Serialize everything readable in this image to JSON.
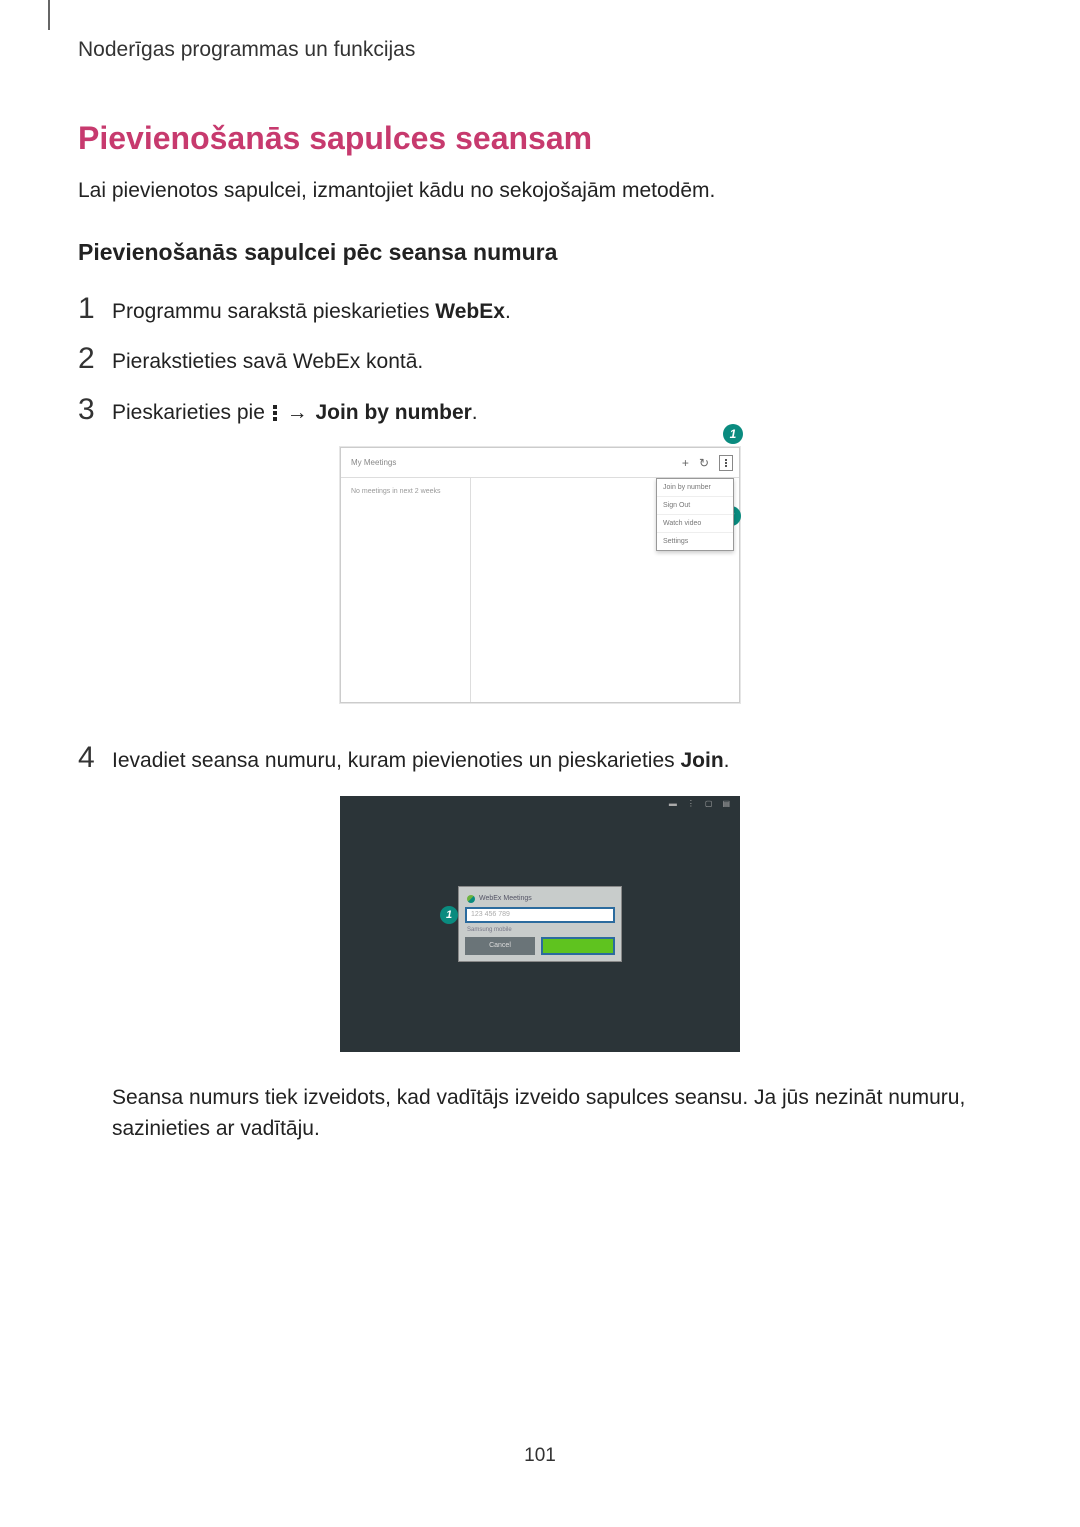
{
  "header": "Noderīgas programmas un funkcijas",
  "title": "Pievienošanās sapulces seansam",
  "intro": "Lai pievienotos sapulcei, izmantojiet kādu no sekojošajām metodēm.",
  "subtitle": "Pievienošanās sapulcei pēc seansa numura",
  "steps": {
    "s1": {
      "num": "1",
      "pre": "Programmu sarakstā pieskarieties ",
      "bold": "WebEx",
      "post": "."
    },
    "s2": {
      "num": "2",
      "text": "Pierakstieties savā WebEx kontā."
    },
    "s3": {
      "num": "3",
      "pre": "Pieskarieties pie ",
      "arrow": "→",
      "bold": "Join by number",
      "post": "."
    },
    "s4": {
      "num": "4",
      "pre": "Ievadiet seansa numuru, kuram pievienoties un pieskarieties ",
      "bold": "Join",
      "post": "."
    }
  },
  "shot1": {
    "title": "My Meetings",
    "empty": "No meetings in next 2 weeks",
    "menu": [
      "Join by number",
      "Sign Out",
      "Watch video",
      "Settings"
    ]
  },
  "shot2": {
    "dialog_title": "WebEx Meetings",
    "input_placeholder": "123 456 789",
    "sub": "Samsung mobile",
    "cancel": "Cancel",
    "join": ""
  },
  "callouts": {
    "c1": "1",
    "c2": "2"
  },
  "note": "Seansa numurs tiek izveidots, kad vadītājs izveido sapulces seansu. Ja jūs nezināt numuru, sazinieties ar vadītāju.",
  "page_number": "101"
}
